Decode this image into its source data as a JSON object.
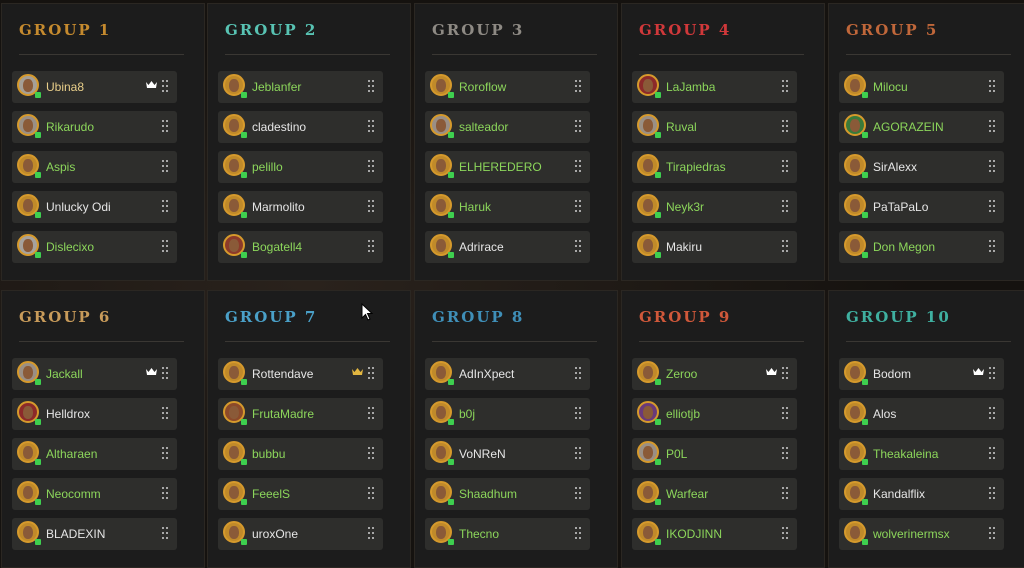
{
  "groups": [
    {
      "title": "GROUP 1",
      "color": "#c58a2e",
      "players": [
        {
          "name": "Ubina8",
          "avatar": "#a59f96",
          "crown": true,
          "name_style": "gold"
        },
        {
          "name": "Rikarudo",
          "avatar": "#9a8f85"
        },
        {
          "name": "Aspis",
          "avatar": "#c08a2a"
        },
        {
          "name": "Unlucky Odi",
          "avatar": "#c08a2a",
          "name_style": "white"
        },
        {
          "name": "Dislecixo",
          "avatar": "#a6a29d"
        }
      ]
    },
    {
      "title": "GROUP 2",
      "color": "#58c3b3",
      "players": [
        {
          "name": "Jeblanfer",
          "avatar": "#c08a2a"
        },
        {
          "name": "cladestino",
          "avatar": "#c08a2a",
          "name_style": "white"
        },
        {
          "name": "pelillo",
          "avatar": "#c08a2a"
        },
        {
          "name": "Marmolito",
          "avatar": "#c08a2a",
          "name_style": "white"
        },
        {
          "name": "Bogatell4",
          "avatar": "#8c3a2a"
        }
      ]
    },
    {
      "title": "GROUP 3",
      "color": "#8e8a84",
      "players": [
        {
          "name": "Roroflow",
          "avatar": "#c08a2a"
        },
        {
          "name": "salteador",
          "avatar": "#9a8f85"
        },
        {
          "name": "ELHEREDERO",
          "avatar": "#c08a2a"
        },
        {
          "name": "Haruk",
          "avatar": "#c08a2a"
        },
        {
          "name": "Adrirace",
          "avatar": "#c08a2a",
          "name_style": "white"
        }
      ]
    },
    {
      "title": "GROUP 4",
      "color": "#d0383a",
      "players": [
        {
          "name": "LaJamba",
          "avatar": "#8c2a2a"
        },
        {
          "name": "Ruval",
          "avatar": "#9a8f85"
        },
        {
          "name": "Tirapiedras",
          "avatar": "#c08a2a"
        },
        {
          "name": "Neyk3r",
          "avatar": "#c08a2a"
        },
        {
          "name": "Makiru",
          "avatar": "#c08a2a",
          "name_style": "white"
        }
      ]
    },
    {
      "title": "GROUP 5",
      "color": "#c0673a",
      "players": [
        {
          "name": "Milocu",
          "avatar": "#c08a2a"
        },
        {
          "name": "AGORAZEIN",
          "avatar": "#3a7a3a"
        },
        {
          "name": "SirAlexx",
          "avatar": "#c08a2a",
          "name_style": "white"
        },
        {
          "name": "PaTaPaLo",
          "avatar": "#c08a2a",
          "name_style": "white"
        },
        {
          "name": "Don Megon",
          "avatar": "#c08a2a"
        }
      ]
    },
    {
      "title": "GROUP 6",
      "color": "#c89b5a",
      "players": [
        {
          "name": "Jackall",
          "avatar": "#9a8f85",
          "crown": true
        },
        {
          "name": "Helldrox",
          "avatar": "#8c2a2a",
          "name_style": "white"
        },
        {
          "name": "Altharaen",
          "avatar": "#c08a2a"
        },
        {
          "name": "Neocomm",
          "avatar": "#c08a2a"
        },
        {
          "name": "BLADEXIN",
          "avatar": "#c08a2a",
          "name_style": "white"
        }
      ]
    },
    {
      "title": "GROUP 7",
      "color": "#4aa0c8",
      "players": [
        {
          "name": "Rottendave",
          "avatar": "#c08a2a",
          "crown": true,
          "crown_color": "#e2b640",
          "name_style": "white"
        },
        {
          "name": "FrutaMadre",
          "avatar": "#8c4a2a"
        },
        {
          "name": "bubbu",
          "avatar": "#c08a2a"
        },
        {
          "name": "FeeelS",
          "avatar": "#c08a2a"
        },
        {
          "name": "uroxOne",
          "avatar": "#c08a2a",
          "name_style": "white"
        }
      ]
    },
    {
      "title": "GROUP 8",
      "color": "#3f8fb8",
      "players": [
        {
          "name": "AdInXpect",
          "avatar": "#c08a2a",
          "name_style": "white"
        },
        {
          "name": "b0j",
          "avatar": "#c08a2a"
        },
        {
          "name": "VoNReN",
          "avatar": "#c08a2a",
          "name_style": "white"
        },
        {
          "name": "Shaadhum",
          "avatar": "#c08a2a"
        },
        {
          "name": "Thecno",
          "avatar": "#c08a2a"
        }
      ]
    },
    {
      "title": "GROUP 9",
      "color": "#d0583a",
      "players": [
        {
          "name": "Zeroo",
          "avatar": "#c08a2a",
          "crown": true
        },
        {
          "name": "elliotjb",
          "avatar": "#6a3a7a"
        },
        {
          "name": "P0L",
          "avatar": "#9a8f85"
        },
        {
          "name": "Warfear",
          "avatar": "#c08a2a"
        },
        {
          "name": "IKODJINN",
          "avatar": "#c08a2a"
        }
      ]
    },
    {
      "title": "GROUP 10",
      "color": "#3fb0a0",
      "players": [
        {
          "name": "Bodom",
          "avatar": "#c08a2a",
          "crown": true,
          "name_style": "white"
        },
        {
          "name": "Alos",
          "avatar": "#c08a2a",
          "name_style": "white"
        },
        {
          "name": "Theakaleina",
          "avatar": "#c08a2a"
        },
        {
          "name": "Kandalflix",
          "avatar": "#c08a2a",
          "name_style": "white"
        },
        {
          "name": "wolverinermsx",
          "avatar": "#c08a2a"
        }
      ]
    }
  ],
  "icons": {
    "crown": "crown-icon",
    "drag": "drag-handle-icon",
    "status": "online-status-icon",
    "cursor": "mouse-cursor-icon"
  },
  "colors": {
    "panel_bg": "#1c1c1c",
    "row_bg": "#2e2e2c",
    "online": "#3ecf4f",
    "name_green": "#8cd65b"
  }
}
